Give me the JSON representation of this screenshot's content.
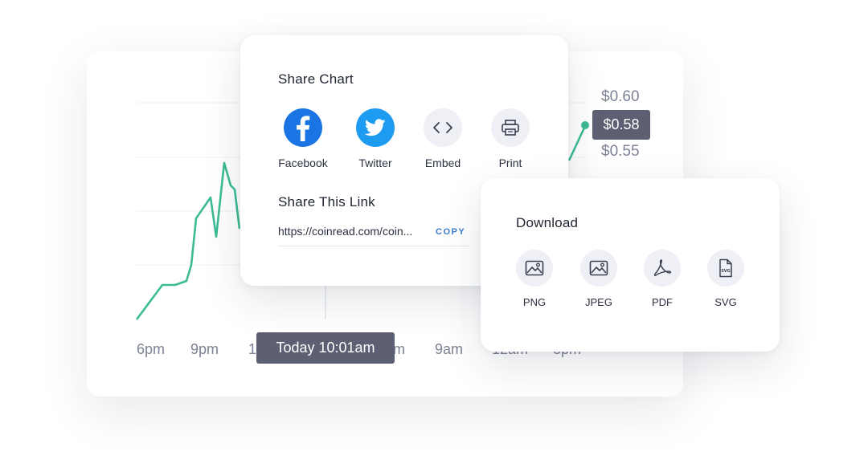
{
  "share": {
    "title": "Share Chart",
    "options": [
      {
        "label": "Facebook",
        "icon": "facebook-icon"
      },
      {
        "label": "Twitter",
        "icon": "twitter-icon"
      },
      {
        "label": "Embed",
        "icon": "code-icon"
      },
      {
        "label": "Print",
        "icon": "printer-icon"
      }
    ],
    "link_title": "Share This Link",
    "link_url": "https://coinread.com/coin...",
    "copy_label": "COPY"
  },
  "download": {
    "title": "Download",
    "options": [
      {
        "label": "PNG",
        "icon": "image-icon"
      },
      {
        "label": "JPEG",
        "icon": "image-icon"
      },
      {
        "label": "PDF",
        "icon": "pdf-icon"
      },
      {
        "label": "SVG",
        "icon": "svg-file-icon"
      }
    ]
  },
  "price_labels": {
    "top": "$0.60",
    "current": "$0.58",
    "bottom": "$0.55"
  },
  "x_labels": [
    "6pm",
    "9pm",
    "1",
    "m",
    "9am",
    "12am",
    "3pm"
  ],
  "time_tooltip": "Today  10:01am",
  "colors": {
    "line": "#3dbb94",
    "tooltip_bg": "#5d6072",
    "facebook": "#1b74e4",
    "twitter": "#1d9bf0",
    "copy": "#3b7bc9"
  }
}
